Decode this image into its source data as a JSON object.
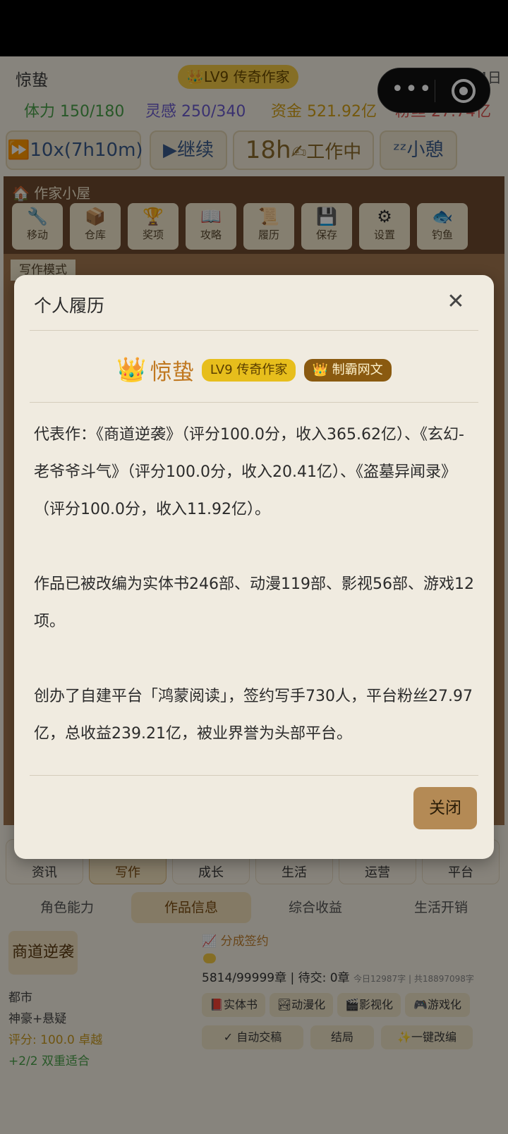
{
  "header": {
    "player_name": "惊蛰",
    "level_badge": "👑LV9 传奇作家",
    "date": "第21年3月4日",
    "stats": {
      "stamina": "体力 150/180",
      "inspiration": "灵感 250/340",
      "funds": "资金 521.92亿",
      "fans": "粉丝 27.74亿"
    }
  },
  "controls": {
    "speed": "⏩10x(7h10m)",
    "continue": "▶继续",
    "hours": "18h",
    "working": "✍工作中",
    "rest": "ᶻᶻ小憩"
  },
  "house": {
    "title": "🏠 作家小屋",
    "tools": [
      {
        "icon": "🔧",
        "label": "移动"
      },
      {
        "icon": "📦",
        "label": "仓库"
      },
      {
        "icon": "🏆",
        "label": "奖项"
      },
      {
        "icon": "📖",
        "label": "攻略"
      },
      {
        "icon": "📜",
        "label": "履历"
      },
      {
        "icon": "💾",
        "label": "保存"
      },
      {
        "icon": "⚙",
        "label": "设置"
      },
      {
        "icon": "🐟",
        "label": "钓鱼"
      }
    ],
    "mode_tab": "写作模式"
  },
  "nav": [
    "资讯",
    "写作",
    "成长",
    "生活",
    "运营",
    "平台"
  ],
  "sub_tabs": [
    "角色能力",
    "作品信息",
    "综合收益",
    "生活开销"
  ],
  "work": {
    "title": "商道逆袭",
    "genre": "都市",
    "tags": "神豪+悬疑",
    "score": "评分: 100.0 卓越",
    "fit": "+2/2 双重适合",
    "sign_title": "📈 分成签约",
    "progress": "5814/99999章 | 待交: 0章",
    "progress_small": "今日12987字 | 共18897098字",
    "chips_row1": [
      "📕实体书",
      "🏞动漫化",
      "🎬影视化",
      "🎮游戏化"
    ],
    "chips_row2": [
      "✓ 自动交稿",
      "结局",
      "✨一键改编"
    ]
  },
  "modal": {
    "title": "个人履历",
    "close_x": "✕",
    "crown": "👑",
    "name": "惊蛰",
    "level": "LV9 传奇作家",
    "dominance": "👑 制霸网文",
    "paragraphs": [
      "代表作：《商道逆袭》（评分100.0分，收入365.62亿）、《玄幻-老爷爷斗气》（评分100.0分，收入20.41亿）、《盗墓异闻录》（评分100.0分，收入11.92亿）。",
      "作品已被改编为实体书246部、动漫119部、影视56部、游戏12项。",
      "创办了自建平台「鸿蒙阅读」，签约写手730人，平台粉丝27.97亿，总收益239.21亿，被业界誉为头部平台。"
    ],
    "close_button": "关闭"
  },
  "colors": {
    "stamina": "#4aa04a",
    "inspiration": "#6a5acd",
    "funds": "#d4a017",
    "fans": "#d9534f",
    "modal_bg": "#f0ebe0",
    "close_button_bg": "#b48a55",
    "level_badge": "#e7be1c",
    "dominance_badge": "#8a5a10"
  }
}
